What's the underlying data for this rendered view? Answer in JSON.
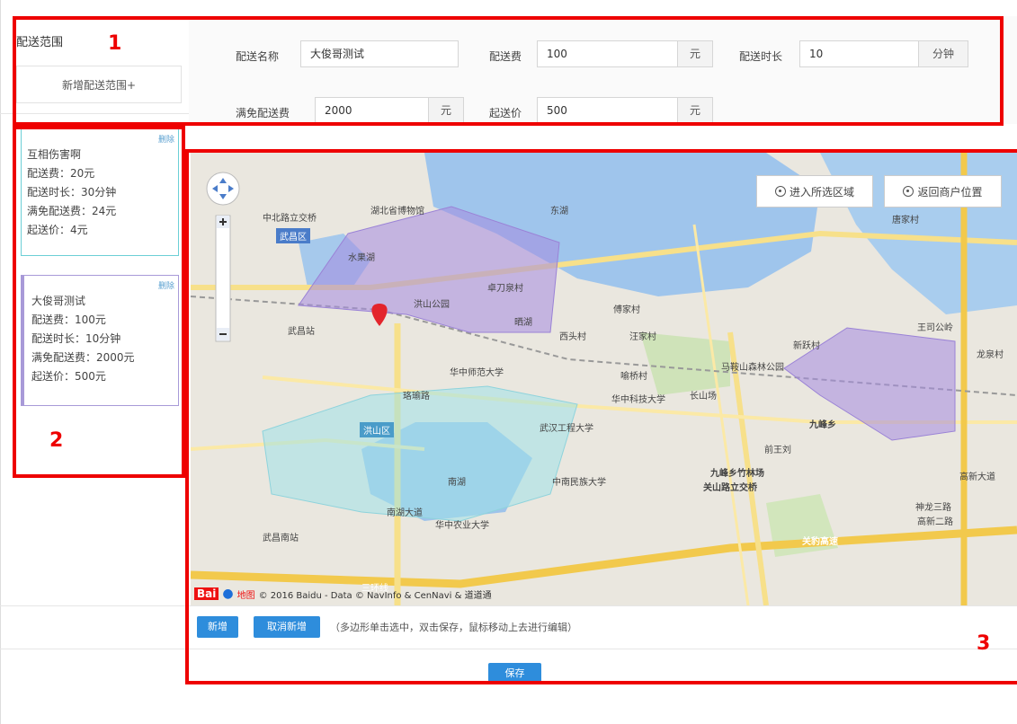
{
  "sidebar": {
    "title": "配送范围",
    "add_button": "新增配送范围+",
    "cards": [
      {
        "delete_label": "删除",
        "name": "互相伤害啊",
        "fee": "配送费：20元",
        "duration": "配送时长：30分钟",
        "free_fee": "满免配送费：24元",
        "min_price": "起送价：4元",
        "border_color": "#6ccfd6"
      },
      {
        "delete_label": "删除",
        "name": "大俊哥测试",
        "fee": "配送费：100元",
        "duration": "配送时长：10分钟",
        "free_fee": "满免配送费：2000元",
        "min_price": "起送价：500元",
        "border_color": "#a89ad8"
      }
    ]
  },
  "form": {
    "name_label": "配送名称",
    "name_value": "大俊哥测试",
    "fee_label": "配送费",
    "fee_value": "100",
    "fee_unit": "元",
    "duration_label": "配送时长",
    "duration_value": "10",
    "duration_unit": "分钟",
    "free_label": "满免配送费",
    "free_value": "2000",
    "free_unit": "元",
    "min_label": "起送价",
    "min_value": "500",
    "min_unit": "元"
  },
  "map": {
    "enter_area_button": "进入所选区域",
    "return_button": "返回商户位置",
    "labels": [
      "武昌区",
      "洪山区",
      "中北路立交桥",
      "水果湖",
      "武昌站",
      "华中师范大学",
      "华中科技大学",
      "武汉工程大学",
      "中南民族大学",
      "华中农业大学",
      "马鞍山森林公园",
      "九峰乡",
      "关豹高速",
      "九峰乡竹林场",
      "关山路立交桥",
      "南湖",
      "东湖",
      "湖北省博物馆",
      "珞瑜路",
      "南湖大道",
      "高新大道",
      "高新二路",
      "武昌南站",
      "洪山公园",
      "傅家村",
      "汪家村",
      "喻桥村",
      "西头村",
      "新跃村",
      "王司公岭",
      "龙泉村",
      "唐家村",
      "晒湖",
      "三环线",
      "卓刀泉村",
      "长山场",
      "前王刘",
      "神龙三路"
    ],
    "copyright": "© 2016 Baidu - Data © NavInfo & CenNavi & 道道通",
    "logo_text": "Bai",
    "logo_suffix": "地图",
    "poly_colors": {
      "purple": "#a48be0",
      "cyan": "#9fe1e8"
    }
  },
  "actions": {
    "add": "新增",
    "cancel_add": "取消新增",
    "hint": "（多边形单击选中，双击保存，鼠标移动上去进行编辑）",
    "save": "保存"
  },
  "annotations": {
    "one": "1",
    "two": "2",
    "three": "3"
  }
}
